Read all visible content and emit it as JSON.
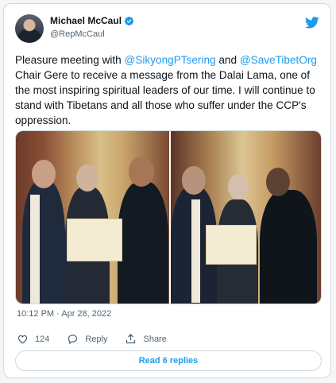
{
  "author": {
    "name": "Michael McCaul",
    "handle": "@RepMcCaul"
  },
  "tweet": {
    "text_1": "Pleasure meeting with ",
    "mention_1": "@SikyongPTsering",
    "text_2": " and ",
    "mention_2": "@SaveTibetOrg",
    "text_3": " Chair Gere to receive a message from the Dalai Lama, one of the most inspiring spiritual leaders of our time. I will continue to stand with Tibetans and all those who suffer under the CCP's oppression.",
    "timestamp": "10:12 PM · Apr 28, 2022"
  },
  "actions": {
    "like_count": "124",
    "reply_label": "Reply",
    "share_label": "Share"
  },
  "replies_button": "Read 6 replies",
  "colors": {
    "accent": "#1d9bf0",
    "text": "#0f1419",
    "muted": "#536471"
  },
  "icons": [
    "verified-badge-icon",
    "twitter-bird-icon",
    "heart-icon",
    "reply-bubble-icon",
    "share-icon"
  ]
}
